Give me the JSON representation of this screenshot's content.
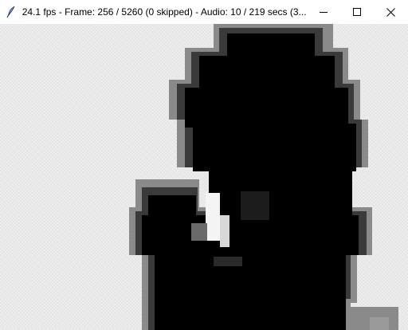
{
  "window": {
    "title": "24.1 fps - Frame: 256 / 5260 (0 skipped) - Audio: 10 / 219 secs (3...",
    "icons": {
      "app": "feather-icon",
      "minimize": "minimize-icon",
      "maximize": "maximize-icon",
      "close": "close-icon"
    }
  },
  "video": {
    "content": "pixelated black silhouette frame",
    "colors": {
      "background": "#e9e9e9",
      "silhouette": "#000000"
    }
  }
}
